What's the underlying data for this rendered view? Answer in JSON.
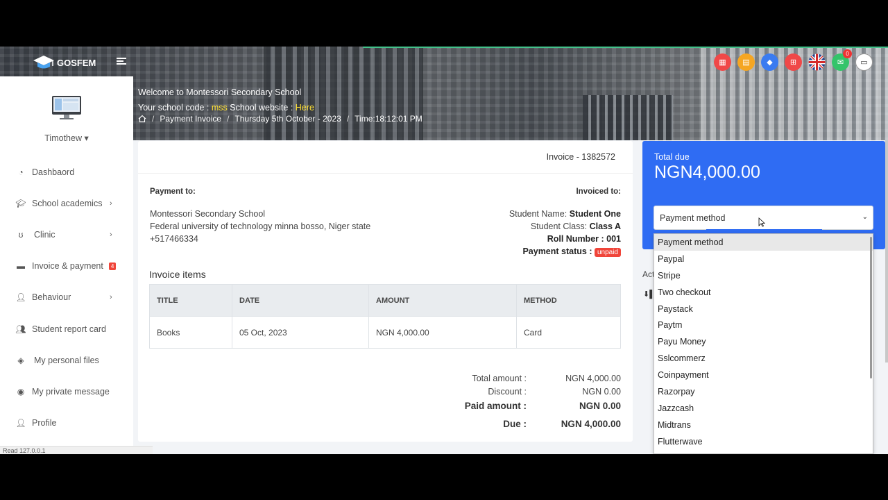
{
  "app": {
    "logo_text": "GOSFEM"
  },
  "header": {
    "welcome_line": "Welcome to Montessori Secondary School",
    "school_code_label": "Your school code :",
    "school_code": "mss",
    "website_label": "School website :",
    "website_link": "Here",
    "notification_count": "0",
    "icon_colors": [
      "#f04848",
      "#f5a623",
      "#3a7bf0",
      "#f04848",
      "#2b5ca8",
      "#34c46a",
      "#ffffff"
    ]
  },
  "breadcrumb": {
    "page": "Payment Invoice",
    "date": "Thursday 5th October - 2023",
    "time": "Time:18:12:01 PM"
  },
  "sidebar": {
    "user_name": "Timothew",
    "items": [
      {
        "label": "Dashbaord",
        "icon": "dashboard-icon",
        "has_chevron": false
      },
      {
        "label": "School academics",
        "icon": "graduation-cap-icon",
        "has_chevron": true
      },
      {
        "label": "Clinic",
        "icon": "stethoscope-icon",
        "has_chevron": true
      },
      {
        "label": "Invoice & payment",
        "icon": "money-icon",
        "count": "4"
      },
      {
        "label": "Behaviour",
        "icon": "user-cog-icon",
        "has_chevron": true
      },
      {
        "label": "Student report card",
        "icon": "users-icon",
        "has_chevron": false
      },
      {
        "label": "My personal files",
        "icon": "file-icon",
        "has_chevron": false
      },
      {
        "label": "My private message",
        "icon": "messenger-icon",
        "has_chevron": false
      },
      {
        "label": "Profile",
        "icon": "user-cog-icon",
        "has_chevron": false
      }
    ]
  },
  "status_bar": "Read 127.0.0.1",
  "invoice": {
    "title": "Invoice - 1382572",
    "payment_to_label": "Payment to:",
    "payment_to": {
      "name": "Montessori Secondary School",
      "address": "Federal university of technology minna bosso, Niger state",
      "phone": "+517466334"
    },
    "invoiced_to_label": "Invoiced to:",
    "invoiced_to": {
      "student_name_label": "Student Name:",
      "student_name": "Student One",
      "student_class_label": "Student Class:",
      "student_class": "Class A",
      "roll_label": "Roll Number :",
      "roll": "001",
      "status_label": "Payment status :",
      "status": "unpaid"
    },
    "items_title": "Invoice items",
    "columns": [
      "TITLE",
      "DATE",
      "AMOUNT",
      "METHOD"
    ],
    "rows": [
      {
        "title": "Books",
        "date": "05 Oct, 2023",
        "amount": "NGN 4,000.00",
        "method": "Card"
      }
    ],
    "totals": {
      "total_label": "Total amount :",
      "total": "NGN 4,000.00",
      "discount_label": "Discount :",
      "discount": "NGN 0.00",
      "paid_label": "Paid amount :",
      "paid": "NGN 0.00",
      "due_label": "Due :",
      "due": "NGN 4,000.00"
    }
  },
  "payment_panel": {
    "total_due_label": "Total due",
    "total_due": "NGN4,000.00",
    "select_value": "Payment method",
    "actions_label": "Act",
    "options": [
      "Payment method",
      "Paypal",
      "Stripe",
      "Two checkout",
      "Paystack",
      "Paytm",
      "Payu Money",
      "Sslcommerz",
      "Coinpayment",
      "Razorpay",
      "Jazzcash",
      "Midtrans",
      "Flutterwave"
    ]
  }
}
